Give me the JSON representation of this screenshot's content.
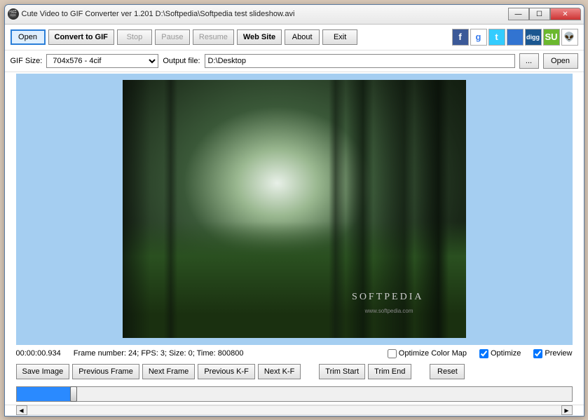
{
  "window": {
    "title": "Cute Video to GIF Converter ver 1.201  D:\\Softpedia\\Softpedia test slideshow.avi"
  },
  "toolbar": {
    "open": "Open",
    "convert": "Convert to GIF",
    "stop": "Stop",
    "pause": "Pause",
    "resume": "Resume",
    "website": "Web Site",
    "about": "About",
    "exit": "Exit"
  },
  "social": [
    {
      "name": "facebook",
      "glyph": "f",
      "bg": "#3b5998"
    },
    {
      "name": "google",
      "glyph": "g",
      "bg": "#ffffff",
      "fg": "#3b7ded"
    },
    {
      "name": "twitter",
      "glyph": "t",
      "bg": "#33ccff"
    },
    {
      "name": "delicious",
      "glyph": "",
      "bg": "#3274d1"
    },
    {
      "name": "digg",
      "glyph": "digg",
      "bg": "#1b5790"
    },
    {
      "name": "stumbleupon",
      "glyph": "SU",
      "bg": "#6bb82e"
    },
    {
      "name": "reddit",
      "glyph": "👽",
      "bg": "#ffffff",
      "fg": "#ff4500"
    }
  ],
  "row2": {
    "gifsize_label": "GIF Size:",
    "gifsize_value": "704x576 - 4cif",
    "output_label": "Output file:",
    "output_value": "D:\\Desktop",
    "browse": "...",
    "open": "Open"
  },
  "preview": {
    "watermark": "SOFTPEDIA",
    "watermark_sub": "www.softpedia.com"
  },
  "status": {
    "time": "00:00:00.934",
    "frame_info": "Frame number: 24; FPS: 3; Size: 0; Time: 800800",
    "optimize_colormap": "Optimize Color Map",
    "optimize": "Optimize",
    "preview": "Preview",
    "optimize_colormap_checked": false,
    "optimize_checked": true,
    "preview_checked": true
  },
  "buttons": {
    "save_image": "Save Image",
    "prev_frame": "Previous Frame",
    "next_frame": "Next Frame",
    "prev_kf": "Previous K-F",
    "next_kf": "Next K-F",
    "trim_start": "Trim Start",
    "trim_end": "Trim End",
    "reset": "Reset"
  }
}
